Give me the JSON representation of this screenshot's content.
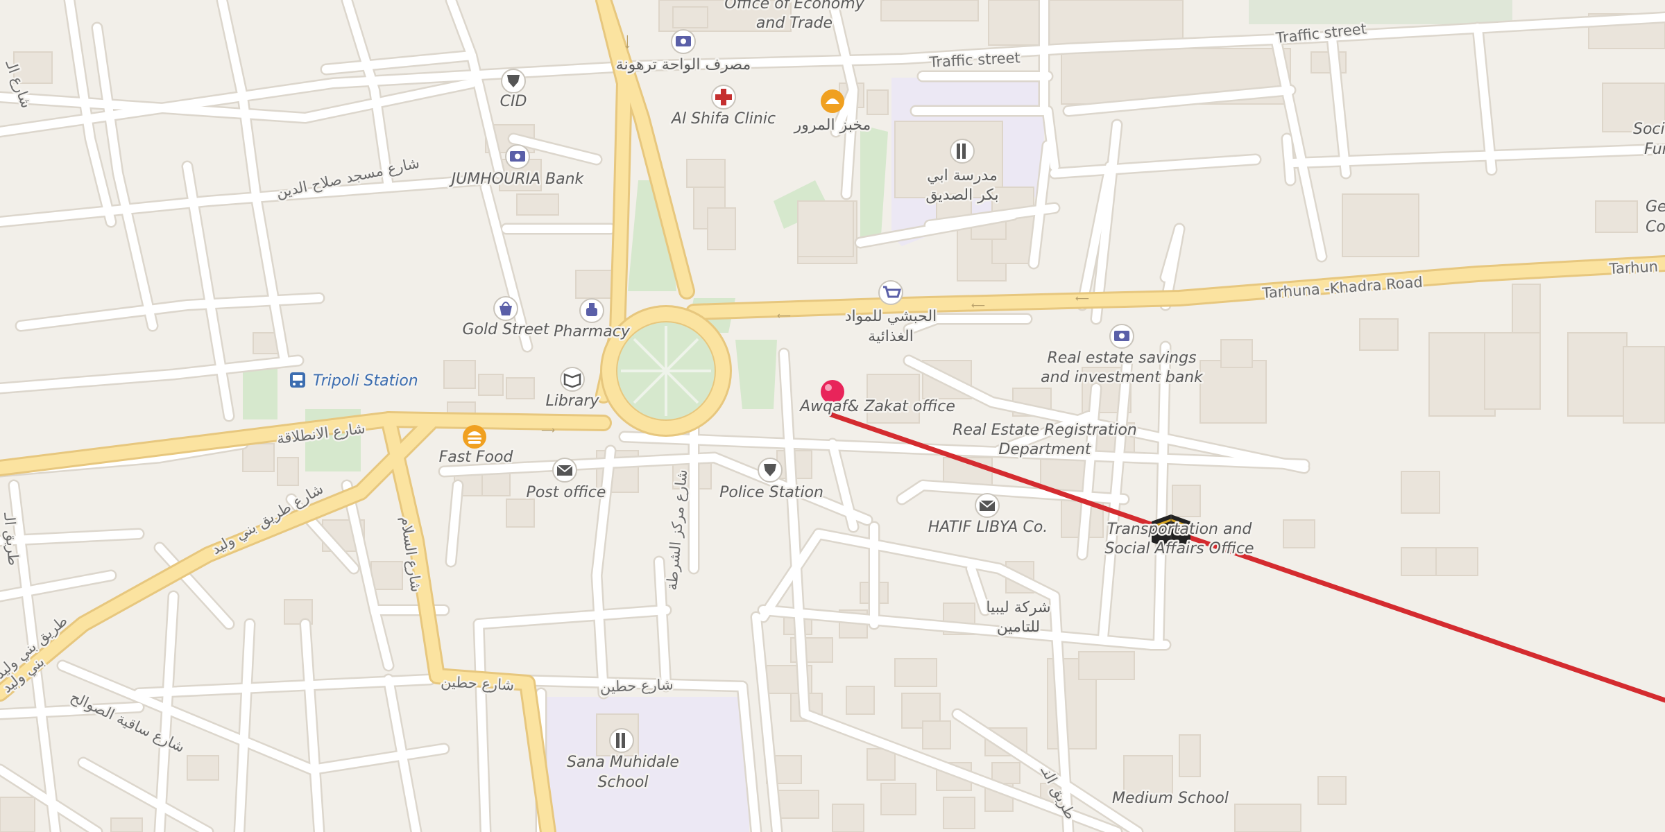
{
  "map": {
    "colors": {
      "background": "#f2efe9",
      "street": "#ffffff",
      "street_casing": "#dcd6cc",
      "major_road": "#fbe3a0",
      "major_road_casing": "#e7c77e",
      "building": "#eae4db",
      "building_outline": "#ddd5c9",
      "park": "#d9ead0",
      "school_area": "#ece8f4",
      "route_line": "#d42b2f",
      "pin": "#e8245a",
      "poi_icon": "#5a5fa8",
      "poi_icon_bg": "#ffffff"
    },
    "roads": [
      {
        "name": "Traffic street"
      },
      {
        "name": "Traffic street"
      },
      {
        "name": "Tarhuna -Khadra Road"
      },
      {
        "name": "Tarhun"
      },
      {
        "name": "شارع الانطلاقة"
      },
      {
        "name": "شارع طريق بني وليد"
      },
      {
        "name": "شارع السلام"
      },
      {
        "name": "شارع حطين"
      },
      {
        "name": "شارع حطين"
      },
      {
        "name": "شارع مسجد صلاح الدين"
      },
      {
        "name": "شارع ساقية الصوالح"
      },
      {
        "name": "شارع مركز الشرطة"
      },
      {
        "name": "طريق بني وليد"
      },
      {
        "name": "بني وليد"
      },
      {
        "name": "طريق النـ"
      },
      {
        "name": "شارع الـ"
      },
      {
        "name": "طريق الـ"
      }
    ],
    "pois": [
      {
        "name": "Office of Economy",
        "name2": "and Trade",
        "icon": "none"
      },
      {
        "name": "مصرف الواحة ترهونة",
        "icon": "bank-icon"
      },
      {
        "name": "CID",
        "icon": "police-icon"
      },
      {
        "name": "Al Shifa Clinic",
        "icon": "clinic-icon"
      },
      {
        "name": "مخبز المرور",
        "icon": "bakery-icon"
      },
      {
        "name": "مدرسة ابي",
        "name2": "بكر الصديق",
        "icon": "school-icon"
      },
      {
        "name": "JUMHOURIA Bank",
        "icon": "bank-icon"
      },
      {
        "name": "Gold Street",
        "icon": "shopping-bag-icon"
      },
      {
        "name": "Pharmacy",
        "icon": "pharmacy-icon"
      },
      {
        "name": "الحبشي للمواد",
        "name2": "الغذائية",
        "icon": "supermarket-icon"
      },
      {
        "name": "Real estate savings",
        "name2": "and investment bank",
        "icon": "bank-icon"
      },
      {
        "name": "Tripoli Station",
        "icon": "bus-icon"
      },
      {
        "name": "Library",
        "icon": "library-icon"
      },
      {
        "name": "Awqaf& Zakat office",
        "icon": "pin-icon"
      },
      {
        "name": "Real Estate Registration",
        "name2": "Department",
        "icon": "none"
      },
      {
        "name": "Fast Food",
        "icon": "fast-food-icon"
      },
      {
        "name": "Post office",
        "icon": "post-icon"
      },
      {
        "name": "Police Station",
        "icon": "police-icon"
      },
      {
        "name": "HATIF LIBYA Co.",
        "icon": "post-icon"
      },
      {
        "name": "Transportation and",
        "name2": "Social Affairs Office",
        "icon": "kaaba-icon"
      },
      {
        "name": "شركة ليبيا",
        "name2": "للتامين",
        "icon": "none"
      },
      {
        "name": "Sana Muhidale",
        "name2": "School",
        "icon": "school-icon"
      },
      {
        "name": "Medium School",
        "icon": "none"
      },
      {
        "name": "Social Sec",
        "name2": "Fun",
        "icon": "none"
      },
      {
        "name": "Genera",
        "name2": "Co",
        "icon": "none"
      }
    ]
  }
}
